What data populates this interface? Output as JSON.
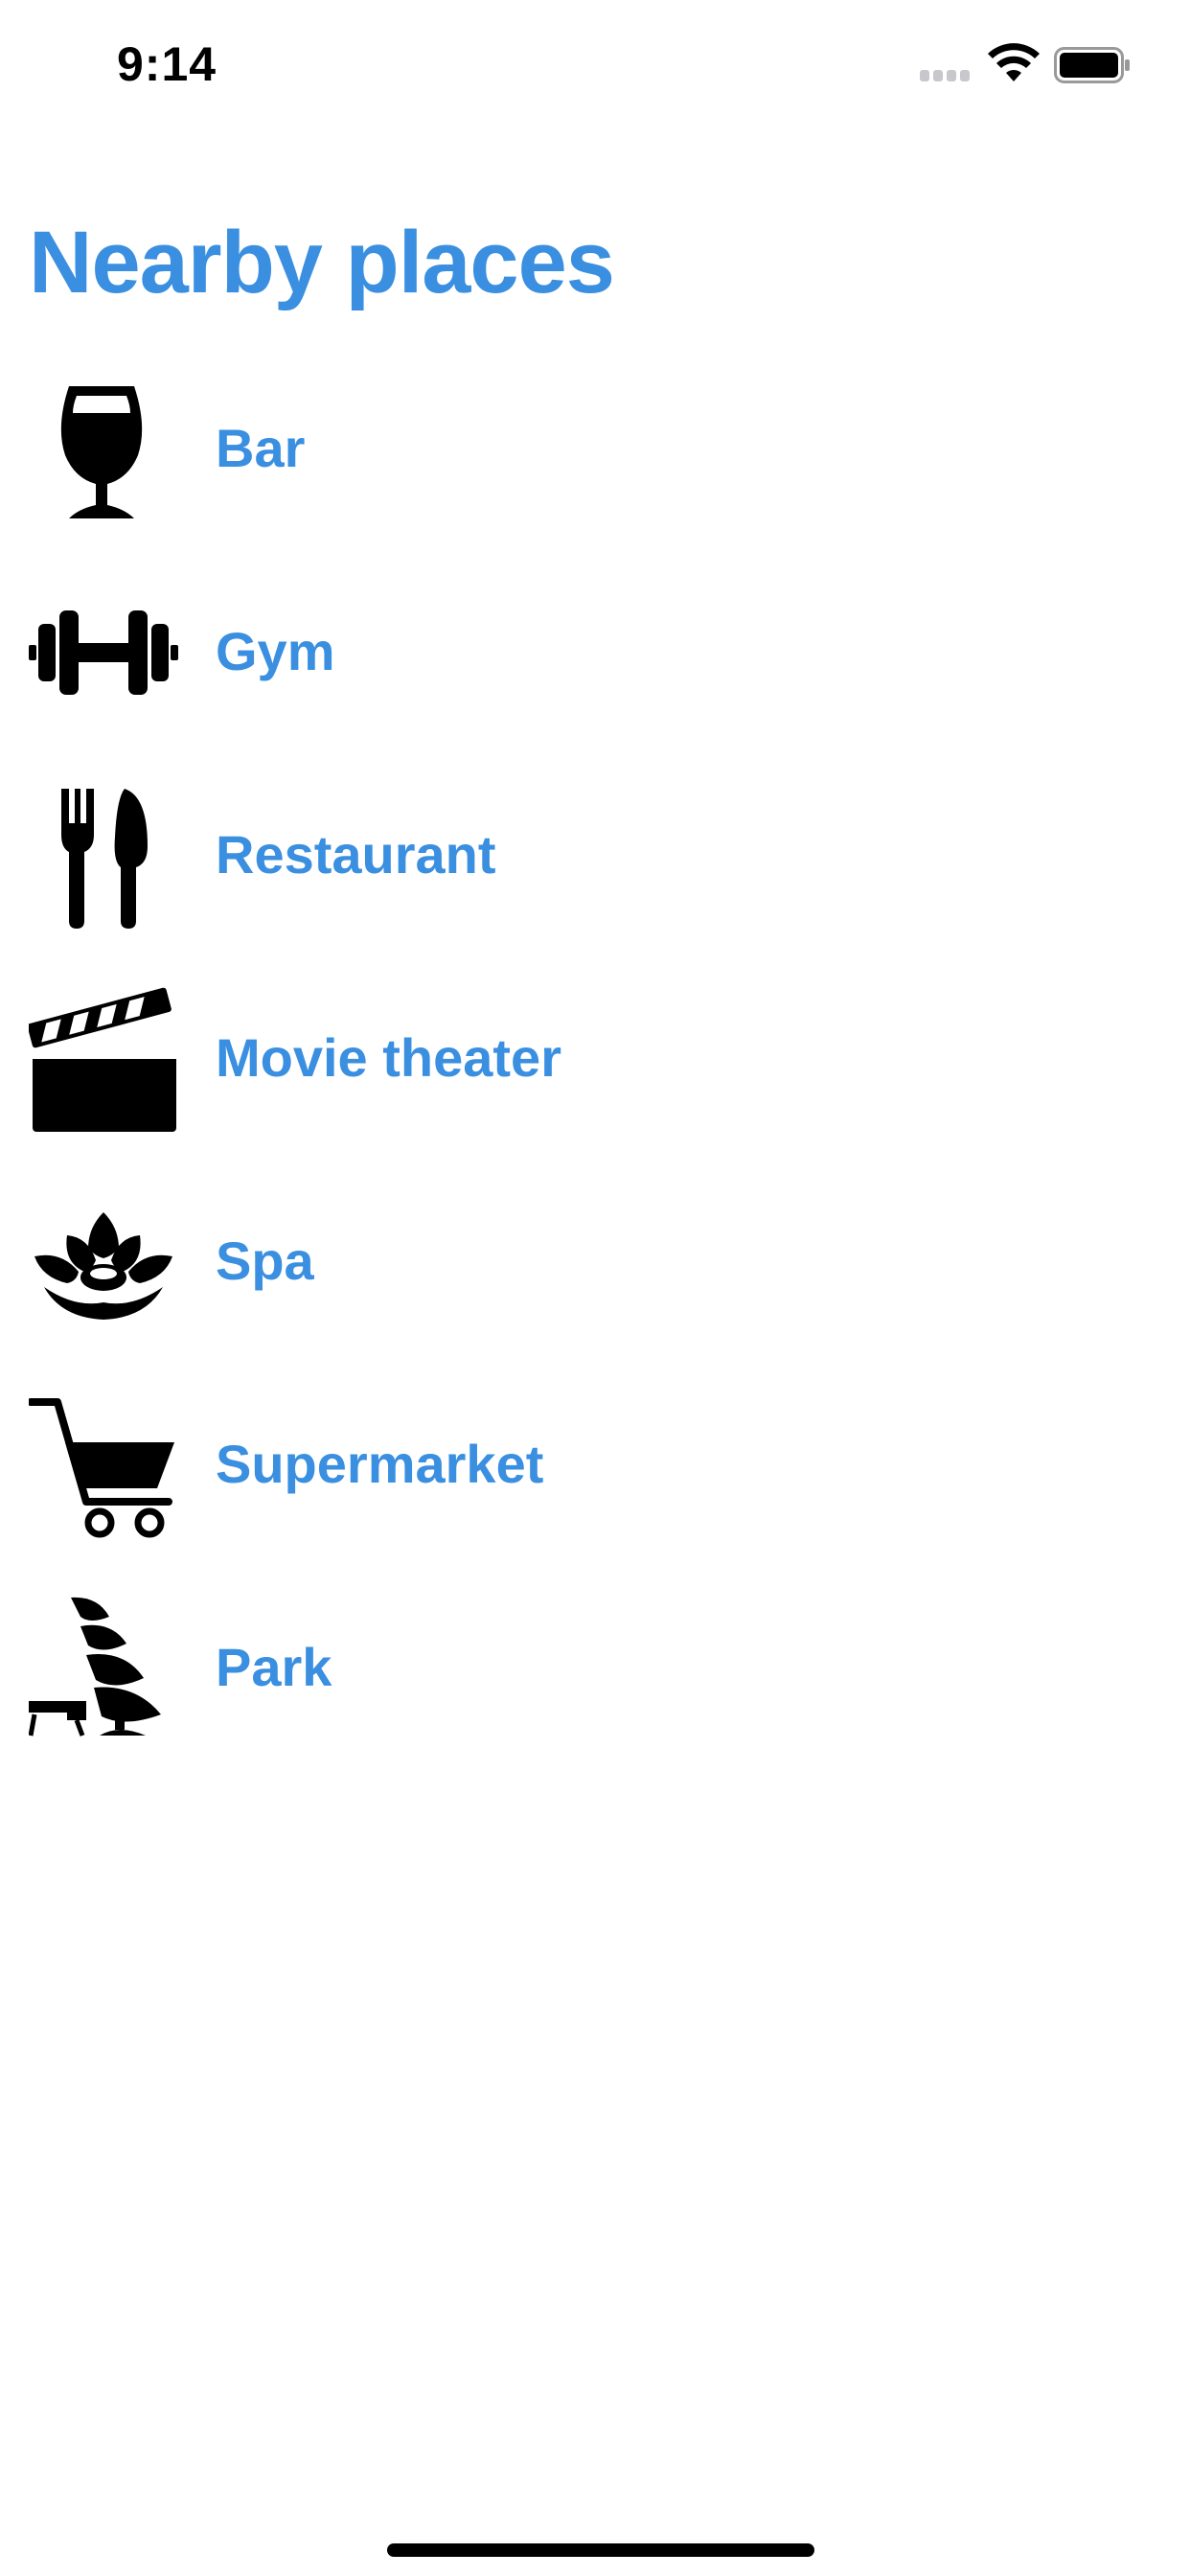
{
  "status_bar": {
    "time": "9:14"
  },
  "header": {
    "title": "Nearby places"
  },
  "places": [
    {
      "label": "Bar",
      "icon": "wine-glass-icon"
    },
    {
      "label": "Gym",
      "icon": "dumbbell-icon"
    },
    {
      "label": "Restaurant",
      "icon": "fork-knife-icon"
    },
    {
      "label": "Movie theater",
      "icon": "clapperboard-icon"
    },
    {
      "label": "Spa",
      "icon": "lotus-icon"
    },
    {
      "label": "Supermarket",
      "icon": "shopping-cart-icon"
    },
    {
      "label": "Park",
      "icon": "park-tree-bench-icon"
    }
  ],
  "colors": {
    "accent": "#3a8fe0",
    "icon": "#000000",
    "background": "#ffffff"
  }
}
